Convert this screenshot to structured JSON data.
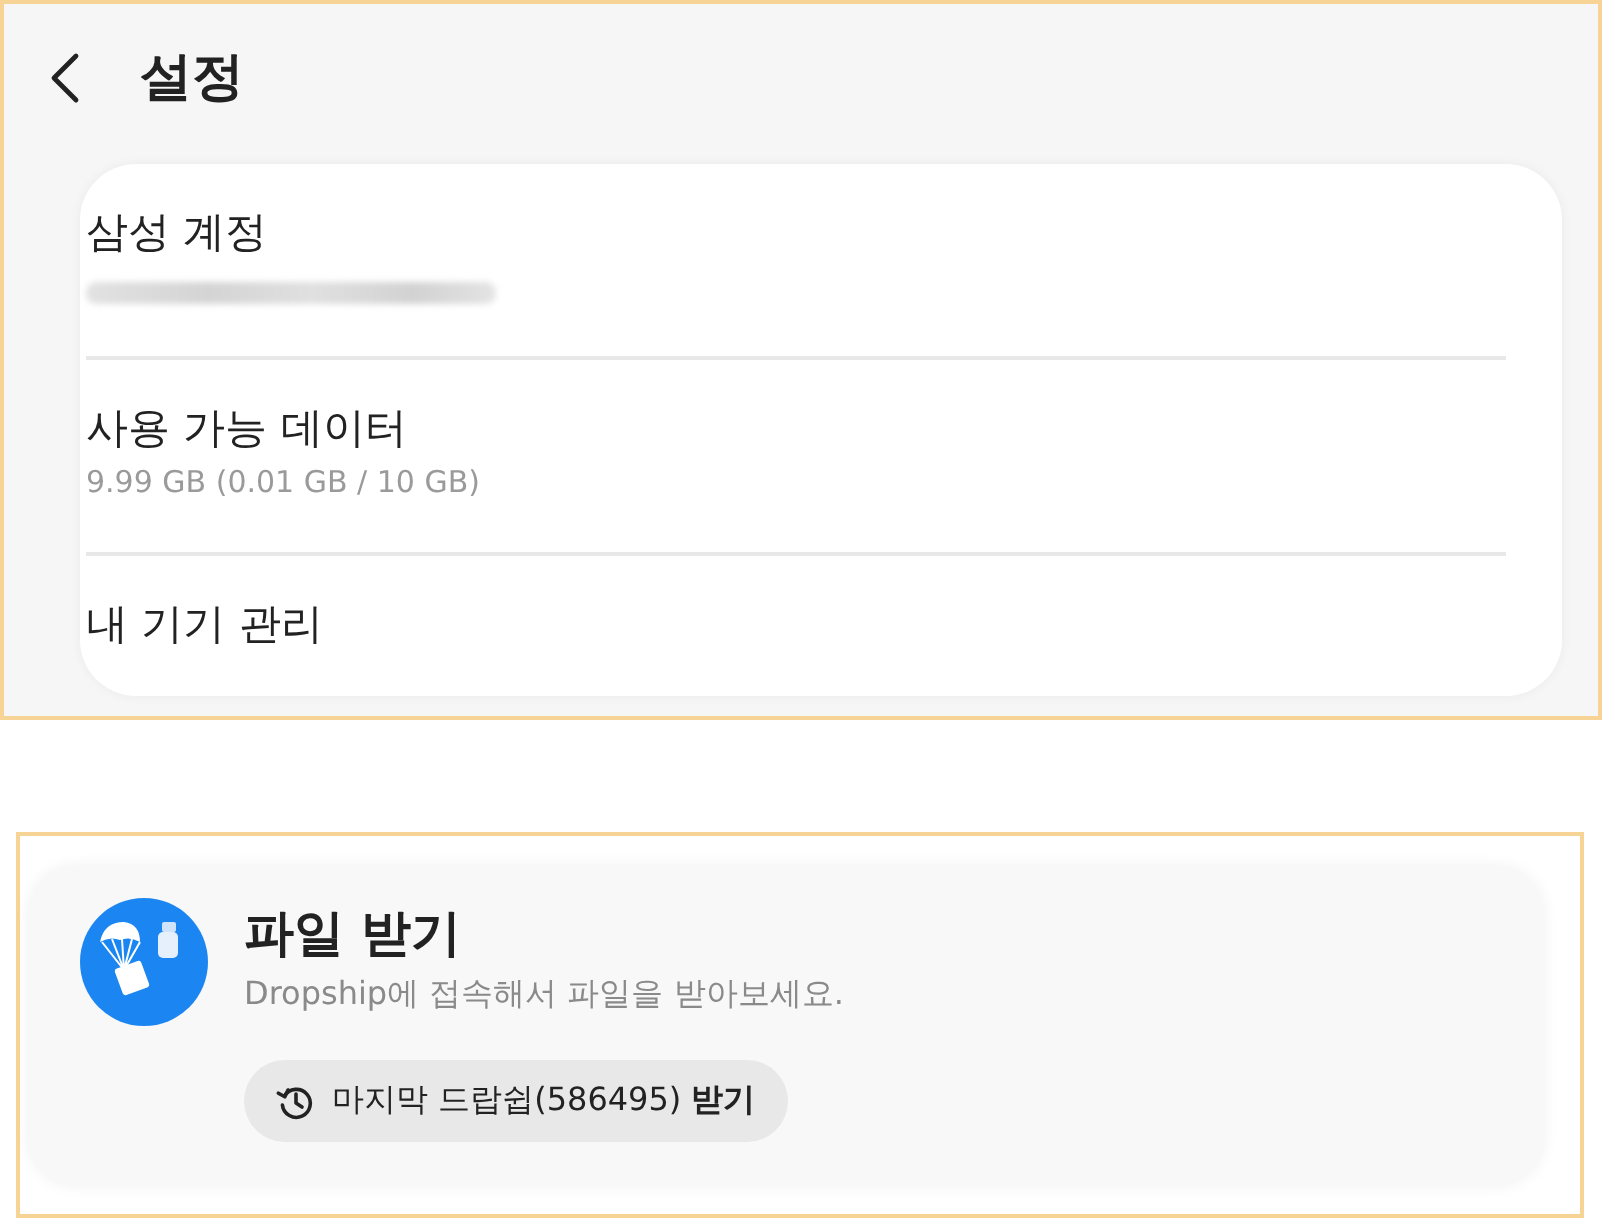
{
  "header": {
    "title": "설정"
  },
  "settings_card": {
    "items": [
      {
        "kind": "account",
        "title": "삼성 계정"
      },
      {
        "kind": "detail",
        "title": "사용 가능 데이터",
        "subtitle": "9.99 GB (0.01 GB / 10 GB)"
      },
      {
        "kind": "plain",
        "title": "내 기기 관리"
      }
    ]
  },
  "receive_card": {
    "title": "파일 받기",
    "description": "Dropship에 접속해서 파일을 받아보세요.",
    "last_drop_button": {
      "label": "마지막 드랍쉽(586495) **받기**"
    }
  }
}
